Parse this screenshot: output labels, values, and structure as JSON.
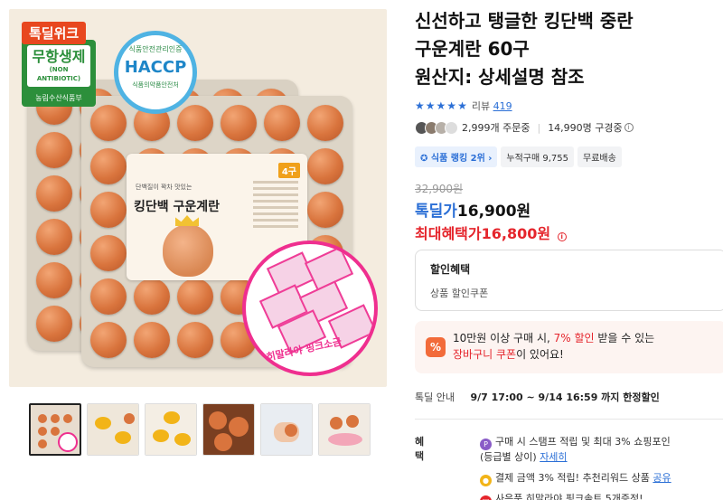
{
  "product": {
    "title": "신선하고 탱글한 킹단백 중란\n구운계란 60구\n원산지: 상세설명 참조",
    "rating_stars": 5,
    "review_label": "리뷰",
    "review_count": "419",
    "buyers": "2,999개 주문중",
    "wishlist": "14,990명 구경중",
    "chips": [
      "식품 랭킹 2위",
      "누적구매 9,755",
      "무료배송"
    ],
    "original_price": "32,900원",
    "deal_label": "톡딜가",
    "deal_price": "16,900원",
    "max_label": "최대혜택가",
    "max_price": "16,800원"
  },
  "image_badges": {
    "deal_tag": "톡딜위크",
    "green_main": "무항생제",
    "green_sub": "(NON ANTIBIOTIC)",
    "green_foot": "농림수산식품부",
    "haccp_top": "식품안전관리인증",
    "haccp_main": "HACCP",
    "haccp_bottom": "식품의약품안전처",
    "label_title": "킹단백 구운계란",
    "label_sub": "단백질이 꽉차 맛있는",
    "label_count": "4구",
    "salt_label": "히말라야 핑크소금"
  },
  "discount_box": {
    "heading": "할인혜택",
    "sub": "상품 할인쿠폰"
  },
  "coupon": {
    "icon": "%",
    "line1_a": "10만원 이상 구매 시, ",
    "line1_b": "7% 할인",
    "line1_c": " 받을 수 있는",
    "line2_a": "장바구니 쿠폰",
    "line2_b": "이 있어요!"
  },
  "deal_info": {
    "key": "톡딜 안내",
    "value": "9/7 17:00 ~ 9/14 16:59 까지 한정할인"
  },
  "benefits": {
    "key": "혜택",
    "item1_icon": "P",
    "item1": "구매 시 스탬프 적립 및 최대 3% 쇼핑포인",
    "item1b": "(등급별 상이)",
    "item1_link": "자세히",
    "item2": "결제 금액 3% 적립! 추천리워드 상품",
    "item2_link": "공유",
    "item3": "사은품 히말라야 핑크솔트 5개증정!"
  },
  "colors": {
    "accent_blue": "#2b6fd6",
    "price_red": "#e5252c",
    "deal_tag": "#e8471f"
  }
}
